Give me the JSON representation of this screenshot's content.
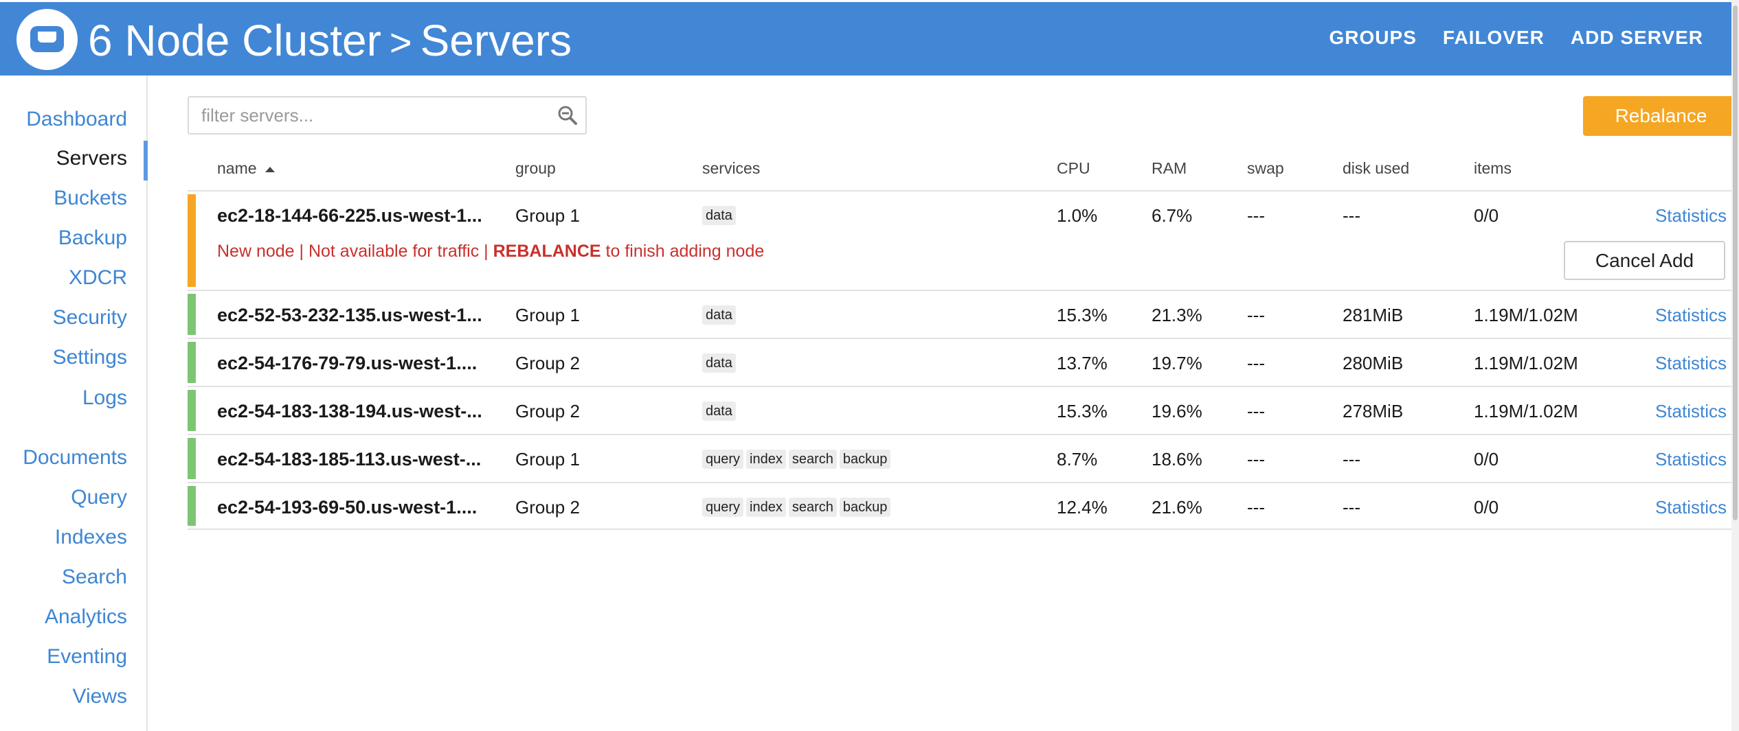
{
  "header": {
    "cluster_name": "6 Node Cluster",
    "separator": ">",
    "page_title": "Servers",
    "nav": [
      "GROUPS",
      "FAILOVER",
      "ADD SERVER"
    ]
  },
  "sidebar": {
    "items": [
      "Dashboard",
      "Servers",
      "Buckets",
      "Backup",
      "XDCR",
      "Security",
      "Settings",
      "Logs",
      "Documents",
      "Query",
      "Indexes",
      "Search",
      "Analytics",
      "Eventing",
      "Views"
    ],
    "active": "Servers"
  },
  "filter": {
    "placeholder": "filter servers...",
    "value": ""
  },
  "rebalance_label": "Rebalance",
  "table": {
    "columns": {
      "name": "name",
      "group": "group",
      "services": "services",
      "cpu": "CPU",
      "ram": "RAM",
      "swap": "swap",
      "disk": "disk used",
      "items": "items"
    },
    "rows": [
      {
        "name": "ec2-18-144-66-225.us-west-1...",
        "group": "Group 1",
        "services": [
          "data"
        ],
        "cpu": "1.0%",
        "ram": "6.7%",
        "swap": "---",
        "disk": "---",
        "items": "0/0",
        "stats": "Statistics",
        "status_color": "#f5a623",
        "warning": {
          "before": "New node | Not available for traffic | ",
          "bold": "REBALANCE",
          "after": " to finish adding node"
        },
        "action": "Cancel Add"
      },
      {
        "name": "ec2-52-53-232-135.us-west-1...",
        "group": "Group 1",
        "services": [
          "data"
        ],
        "cpu": "15.3%",
        "ram": "21.3%",
        "swap": "---",
        "disk": "281MiB",
        "items": "1.19M/1.02M",
        "stats": "Statistics",
        "status_color": "#7dc573"
      },
      {
        "name": "ec2-54-176-79-79.us-west-1....",
        "group": "Group 2",
        "services": [
          "data"
        ],
        "cpu": "13.7%",
        "ram": "19.7%",
        "swap": "---",
        "disk": "280MiB",
        "items": "1.19M/1.02M",
        "stats": "Statistics",
        "status_color": "#7dc573"
      },
      {
        "name": "ec2-54-183-138-194.us-west-...",
        "group": "Group 2",
        "services": [
          "data"
        ],
        "cpu": "15.3%",
        "ram": "19.6%",
        "swap": "---",
        "disk": "278MiB",
        "items": "1.19M/1.02M",
        "stats": "Statistics",
        "status_color": "#7dc573"
      },
      {
        "name": "ec2-54-183-185-113.us-west-...",
        "group": "Group 1",
        "services": [
          "query",
          "index",
          "search",
          "backup"
        ],
        "cpu": "8.7%",
        "ram": "18.6%",
        "swap": "---",
        "disk": "---",
        "items": "0/0",
        "stats": "Statistics",
        "status_color": "#7dc573"
      },
      {
        "name": "ec2-54-193-69-50.us-west-1....",
        "group": "Group 2",
        "services": [
          "query",
          "index",
          "search",
          "backup"
        ],
        "cpu": "12.4%",
        "ram": "21.6%",
        "swap": "---",
        "disk": "---",
        "items": "0/0",
        "stats": "Statistics",
        "status_color": "#7dc573"
      }
    ]
  },
  "colors": {
    "header": "#4287d6",
    "link": "#3e86d2",
    "rebalance": "#f5a623",
    "healthy": "#7dc573",
    "pending": "#f5a623",
    "warning": "#c9302c"
  }
}
